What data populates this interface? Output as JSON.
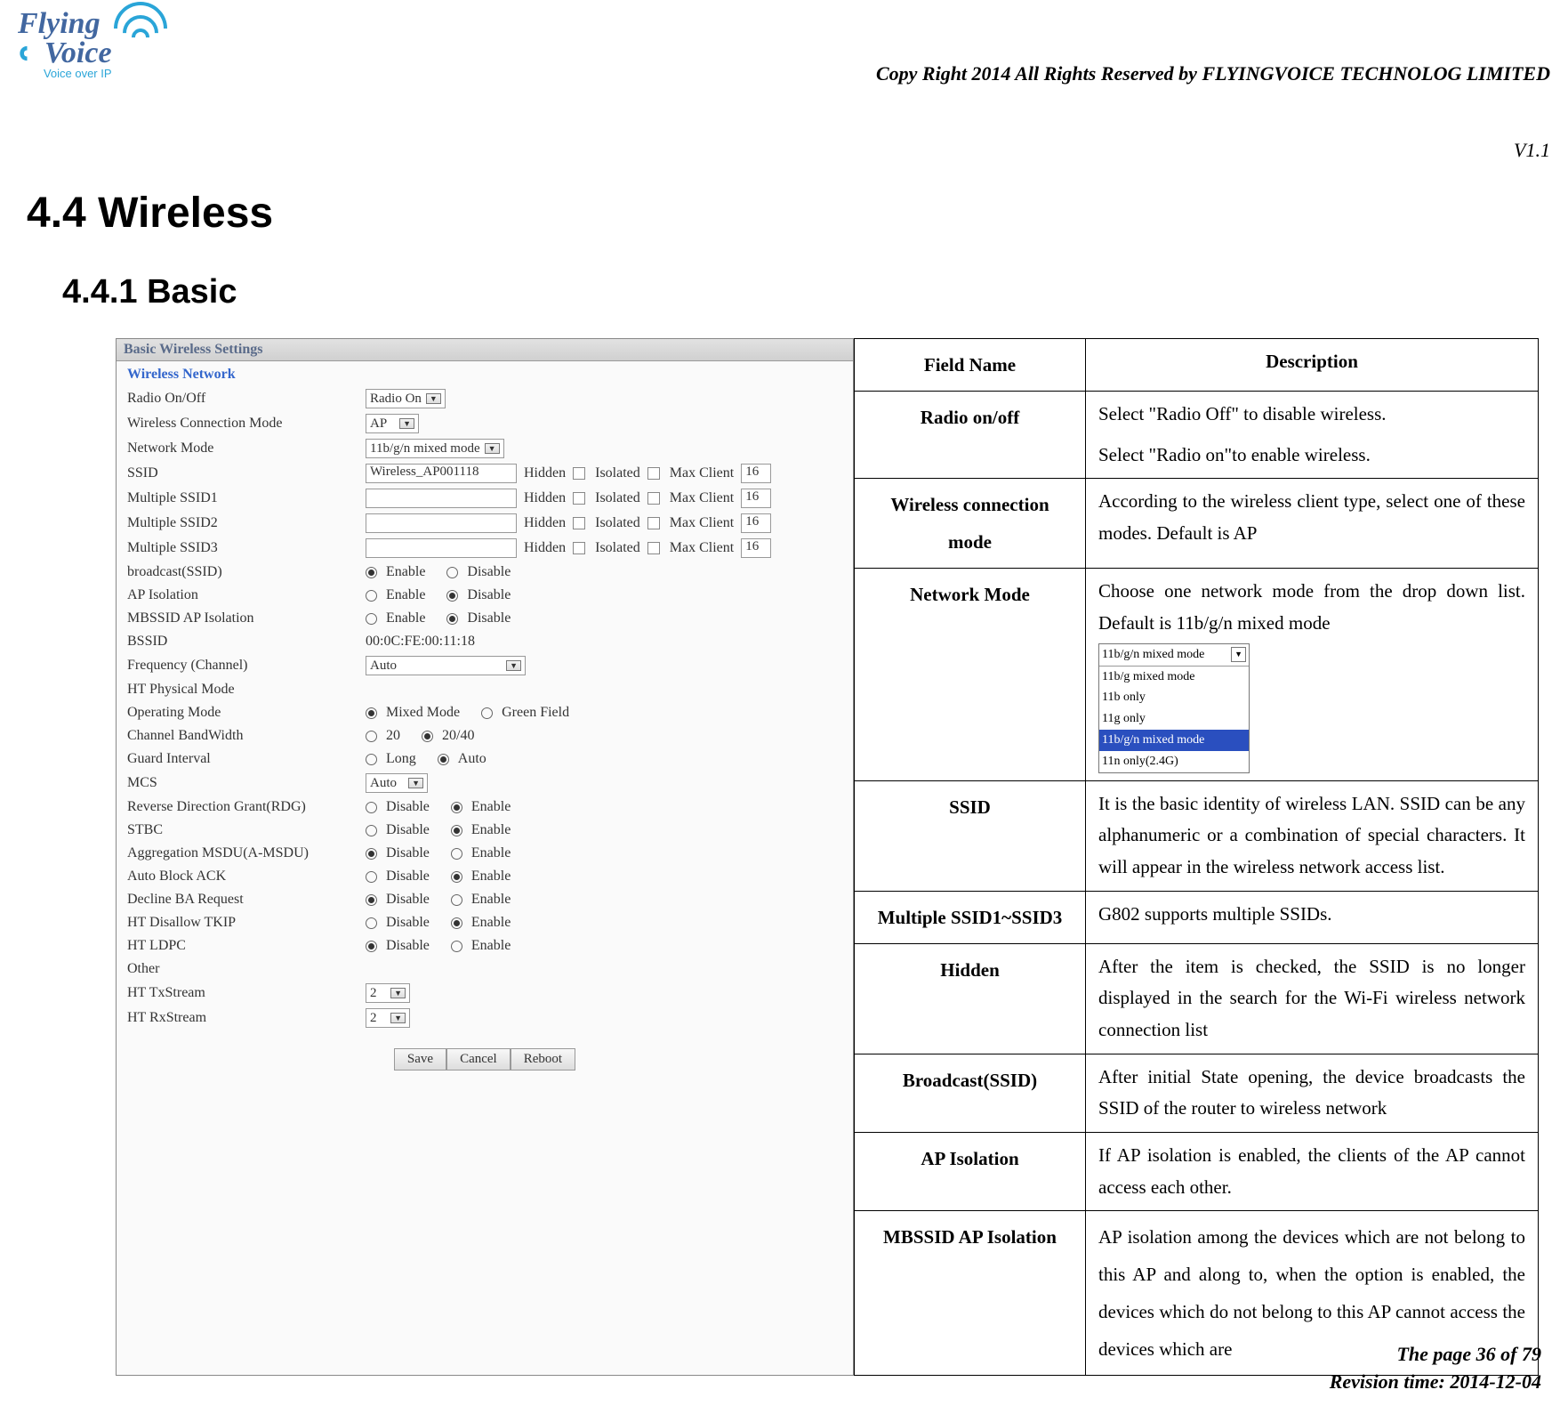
{
  "logo": {
    "line1": "Flying",
    "line2": "Voice",
    "tagline": "Voice over IP"
  },
  "copyright": "Copy Right 2014 All Rights Reserved by FLYINGVOICE TECHNOLOG LIMITED",
  "version": "V1.1",
  "h44": "4.4  Wireless",
  "h441": "4.4.1 Basic",
  "screenshot": {
    "title": "Basic Wireless Settings",
    "section": "Wireless Network",
    "labels": {
      "radio": "Radio On/Off",
      "wcm": "Wireless Connection Mode",
      "nmode": "Network Mode",
      "ssid": "SSID",
      "m1": "Multiple SSID1",
      "m2": "Multiple SSID2",
      "m3": "Multiple SSID3",
      "bcast": "broadcast(SSID)",
      "apiso": "AP Isolation",
      "mbssid": "MBSSID AP Isolation",
      "bssid": "BSSID",
      "freq": "Frequency (Channel)",
      "htphy": "HT Physical Mode",
      "opmode": "Operating Mode",
      "cbw": "Channel BandWidth",
      "gi": "Guard Interval",
      "mcs": "MCS",
      "rdg": "Reverse Direction Grant(RDG)",
      "stbc": "STBC",
      "amsdu": "Aggregation MSDU(A-MSDU)",
      "aback": "Auto Block ACK",
      "dba": "Decline BA Request",
      "htdtkip": "HT Disallow TKIP",
      "htldpc": "HT LDPC",
      "other": "Other",
      "httx": "HT TxStream",
      "htrx": "HT RxStream"
    },
    "values": {
      "radio": "Radio On",
      "wcm": "AP",
      "nmode": "11b/g/n mixed mode",
      "ssid": "Wireless_AP001118",
      "bssidv": "00:0C:FE:00:11:18",
      "freq": "Auto",
      "mcs": "Auto",
      "httx": "2",
      "htrx": "2",
      "maxclient": "16"
    },
    "rlabels": {
      "hidden": "Hidden",
      "isolated": "Isolated",
      "maxclient": "Max Client",
      "enable": "Enable",
      "disable": "Disable",
      "mixed": "Mixed Mode",
      "green": "Green Field",
      "twenty": "20",
      "twenty40": "20/40",
      "long": "Long",
      "auto": "Auto"
    },
    "buttons": {
      "save": "Save",
      "cancel": "Cancel",
      "reboot": "Reboot"
    }
  },
  "table": {
    "h1": "Field Name",
    "h2": "Description",
    "rows": [
      {
        "name": "Radio on/off",
        "desc1": "Select \"Radio Off\" to disable wireless.",
        "desc2": "Select \"Radio on\"to enable wireless."
      },
      {
        "name": "Wireless connection mode",
        "desc": "According to the wireless client type, select one of these modes. Default is AP"
      },
      {
        "name": "Network Mode",
        "desc": "Choose one network mode from the drop down list. Default is 11b/g/n mixed mode",
        "dropdown": {
          "sel": "11b/g/n mixed mode",
          "items": [
            "11b/g mixed mode",
            "11b only",
            "11g only",
            "11b/g/n mixed mode",
            "11n only(2.4G)"
          ],
          "hl": 3
        }
      },
      {
        "name": "SSID",
        "desc": "It is the basic identity of wireless LAN. SSID can be any alphanumeric or a combination of special characters. It will appear in the wireless network access list."
      },
      {
        "name": "Multiple SSID1~SSID3",
        "desc": "G802 supports multiple SSIDs."
      },
      {
        "name": "Hidden",
        "desc": "After the item is checked, the SSID is no longer displayed in the search for the Wi-Fi wireless network connection list"
      },
      {
        "name": "Broadcast(SSID)",
        "desc": "After initial State opening, the device broadcasts the SSID of the router to wireless network"
      },
      {
        "name": "AP Isolation",
        "desc": "If AP isolation is enabled, the clients of the AP cannot access each other."
      },
      {
        "name": "MBSSID AP Isolation",
        "desc": "AP isolation among the devices which are not belong to this AP and along to, when the option is enabled, the devices which do not belong to this AP cannot access the devices which are"
      }
    ]
  },
  "footer": {
    "page": "The page 36 of 79",
    "rev": "Revision time: 2014-12-04"
  }
}
